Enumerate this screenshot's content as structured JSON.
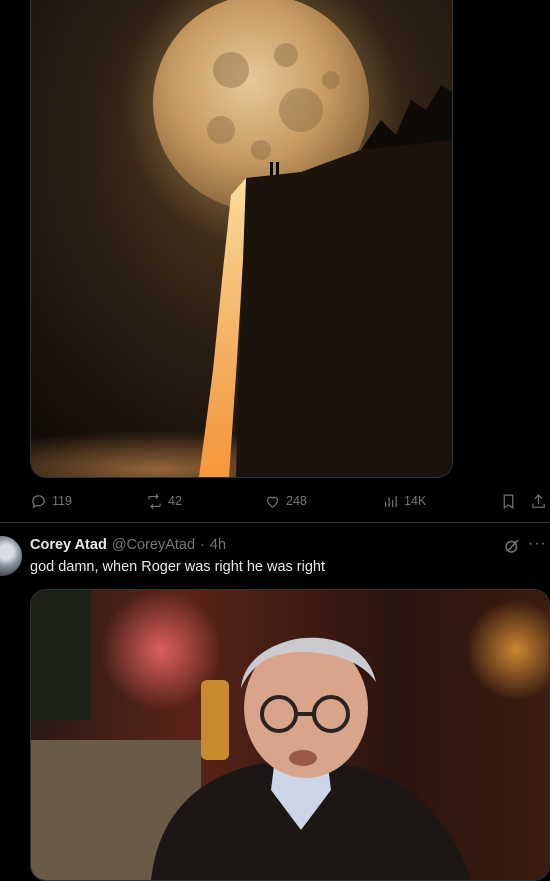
{
  "post1": {
    "image_alt": "full moon waterfall",
    "actions": {
      "replies": "119",
      "reposts": "42",
      "likes": "248",
      "views": "14K"
    }
  },
  "post2": {
    "author_name": "Corey Atad",
    "handle": "@CoreyAtad",
    "separator": "·",
    "time": "4h",
    "text": "god damn, when Roger was right he was right",
    "more_label": "···"
  },
  "colors": {
    "background": "#000000",
    "text": "#e7e9ea",
    "muted": "#71767b",
    "border": "#2f3336"
  }
}
